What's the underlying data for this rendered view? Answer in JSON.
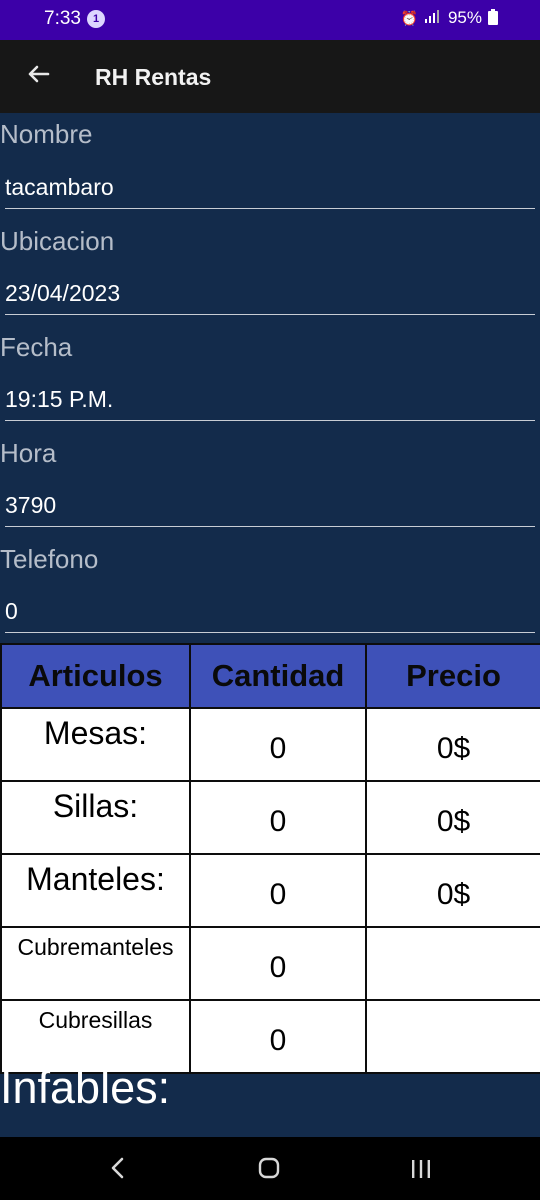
{
  "status_bar": {
    "time": "7:33",
    "notification_count": "1",
    "battery": "95%"
  },
  "app_bar": {
    "title": "RH Rentas"
  },
  "form": {
    "fields": [
      {
        "label": "Nombre",
        "value": "tacambaro"
      },
      {
        "label": "Ubicacion",
        "value": "23/04/2023"
      },
      {
        "label": "Fecha",
        "value": "19:15 P.M."
      },
      {
        "label": "Hora",
        "value": "3790"
      },
      {
        "label": "Telefono",
        "value": "0"
      }
    ]
  },
  "table": {
    "headers": [
      "Articulos",
      "Cantidad",
      "Precio"
    ],
    "rows": [
      {
        "article": "Mesas:",
        "quantity": "0",
        "price": "0$"
      },
      {
        "article": "Sillas:",
        "quantity": "0",
        "price": "0$"
      },
      {
        "article": "Manteles:",
        "quantity": "0",
        "price": "0$"
      },
      {
        "article": "Cubremanteles",
        "quantity": "0",
        "price": ""
      },
      {
        "article": "Cubresillas",
        "quantity": "0",
        "price": ""
      }
    ]
  },
  "section": {
    "title": "Infables:"
  },
  "icons": {
    "back": "arrow-left-icon",
    "alarm": "alarm-icon",
    "signal": "signal-icon",
    "battery": "battery-icon",
    "nav_back": "nav-back-icon",
    "nav_home": "nav-home-icon",
    "nav_recent": "nav-recent-icon"
  },
  "colors": {
    "status_bar": "#3c00a8",
    "app_bar": "#171717",
    "background": "#132b4b",
    "table_header": "#3e51b8"
  }
}
